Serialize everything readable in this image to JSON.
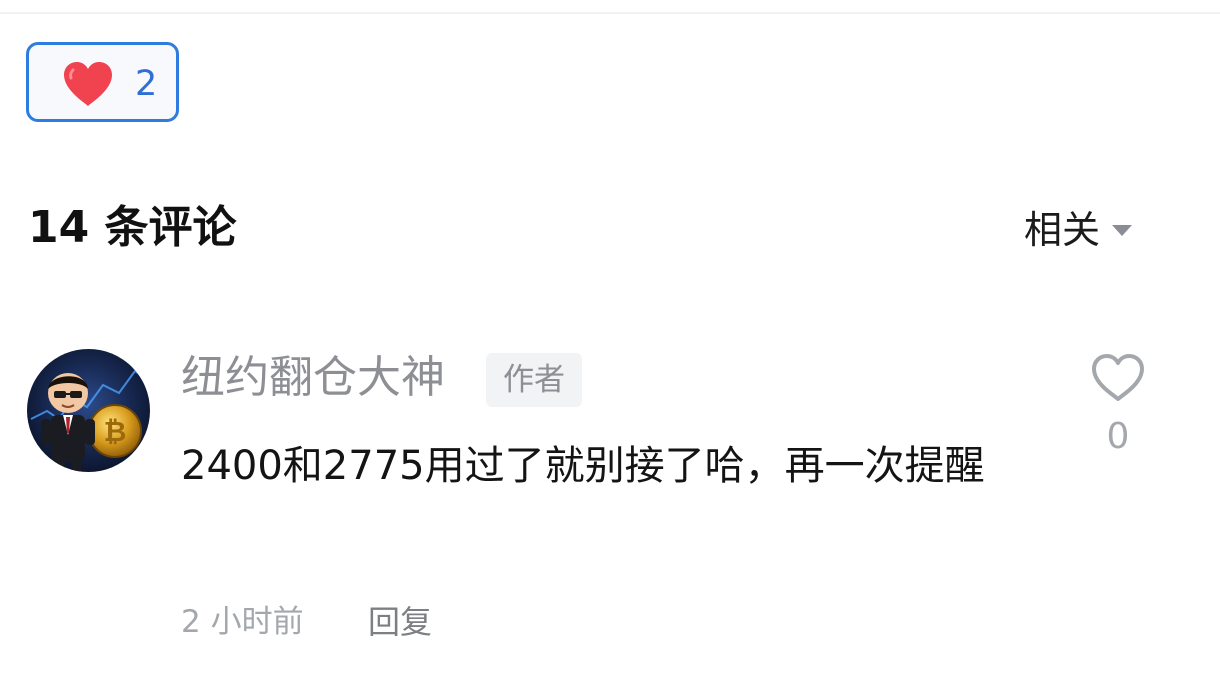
{
  "reaction": {
    "count": "2",
    "icon": "heart-icon",
    "accent": "#2f7ce0",
    "heart_color": "#f0434f"
  },
  "comments_section": {
    "title": "14 条评论",
    "sort": {
      "selected": "相关",
      "icon": "caret-down-icon"
    }
  },
  "comment": {
    "author": "纽约翻仓大神",
    "badge": "作者",
    "text": "2400和2775用过了就别接了哈，再一次提醒",
    "time": "2 小时前",
    "reply_label": "回复",
    "like_count": "0",
    "like_icon": "heart-outline-icon"
  }
}
